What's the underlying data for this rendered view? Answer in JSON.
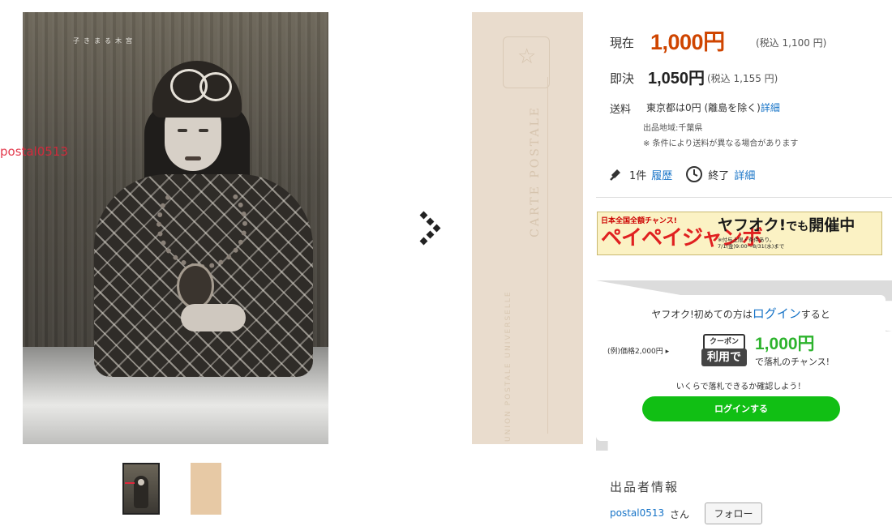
{
  "images": {
    "main_caption": "子きまる木宮",
    "watermark": "postal0513",
    "back_vertical_1": "UNION POSTALE UNIVERSELLE",
    "back_vertical_2": "CARTE POSTALE"
  },
  "price": {
    "current_label": "現在",
    "current_value": "1,000円",
    "current_tax": "(税込 1,100 円)",
    "buyout_label": "即決",
    "buyout_value": "1,050円",
    "buyout_tax": "(税込 1,155 円)"
  },
  "shipping": {
    "label": "送料",
    "text": "東京都は0円 (離島を除く)",
    "detail_link": "詳細",
    "region": "出品地域:千葉県",
    "note": "※ 条件により送料が異なる場合があります"
  },
  "bids": {
    "count": "1件",
    "history_link": "履歴",
    "end_label": "終了",
    "detail_link": "詳細"
  },
  "banner": {
    "line1": "日本全国全額チャンス!",
    "big": "ペイペイジャンボ",
    "right_title_a": "ヤフオク!",
    "right_title_b": "でも",
    "right_title_c": "開催中",
    "note1": "※付与上限・条件あり。",
    "note2": "7/1(金)9:00～8/31(水)まで"
  },
  "login_promo": {
    "line1_pre": "ヤフオク!初めての方は",
    "line1_link": "ログイン",
    "line1_post": "すると",
    "example": "(例)価格2,000円",
    "coupon_top": "クーポン",
    "coupon_bottom": "利用で",
    "coupon_amount": "1,000円",
    "coupon_text": "で落札のチャンス!",
    "confirm": "いくらで落札できるか確認しよう！",
    "button": "ログインする"
  },
  "seller": {
    "title": "出品者情報",
    "name": "postal0513",
    "suffix": "さん",
    "follow": "フォロー"
  },
  "colors": {
    "price_accent": "#cf4500",
    "link": "#1673c7",
    "login_green": "#11bf14"
  }
}
